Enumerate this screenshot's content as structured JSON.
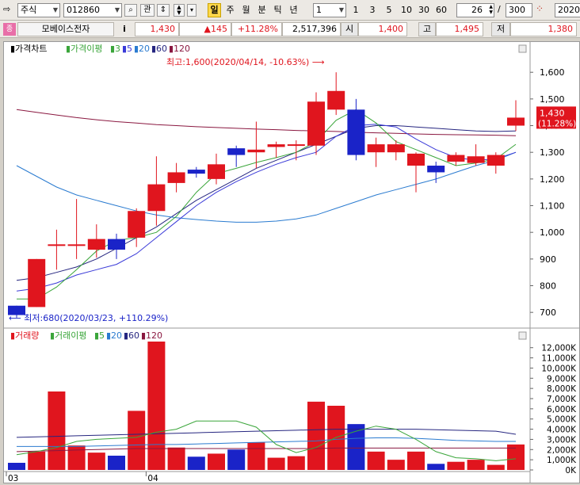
{
  "toolbar": {
    "market": "주식",
    "code": "012860",
    "search_icon": "search-icon",
    "watch_label": "관",
    "period_buttons": [
      "일",
      "주",
      "월",
      "분",
      "틱",
      "년"
    ],
    "active_period": "일",
    "interval_value": "1",
    "interval_buttons": [
      "1",
      "3",
      "5",
      "10",
      "30",
      "60"
    ],
    "count_value": "26",
    "count_sep": "/",
    "count_total": "300",
    "date_value": "2020/"
  },
  "quote": {
    "name": "모베이스전자",
    "info_label": "i",
    "price": "1,430",
    "change": "▲145",
    "change_pct": "+11.28%",
    "volume": "2,517,396",
    "open_label": "시",
    "open": "1,400",
    "high_label": "고",
    "high": "1,495",
    "low_label": "저",
    "low": "1,380"
  },
  "chart_data": [
    {
      "type": "candlestick",
      "title": "가격차트",
      "legend": [
        "가격이평",
        "3",
        "5",
        "20",
        "60",
        "120"
      ],
      "y_ticks": [
        700,
        800,
        900,
        1000,
        1100,
        1200,
        1300,
        1400,
        1500,
        1600
      ],
      "y_tick_labels": [
        "700",
        "800",
        "900",
        "1,000",
        "1,100",
        "1,200",
        "1,300",
        "1,400",
        "1,500",
        "1,600"
      ],
      "ylim": [
        650,
        1660
      ],
      "max_annotation": "최고:1,600(2020/04/14, -10.63%)",
      "min_annotation": "최저:680(2020/03/23, +110.29%)",
      "last_price_label": "1,430",
      "last_pct_label": "(11.28%)",
      "candles": [
        {
          "o": 725,
          "h": 725,
          "l": 680,
          "c": 690
        },
        {
          "o": 720,
          "h": 900,
          "l": 720,
          "c": 900
        },
        {
          "o": 955,
          "h": 1010,
          "l": 860,
          "c": 955
        },
        {
          "o": 950,
          "h": 1125,
          "l": 900,
          "c": 955
        },
        {
          "o": 935,
          "h": 1030,
          "l": 905,
          "c": 975
        },
        {
          "o": 975,
          "h": 995,
          "l": 900,
          "c": 935
        },
        {
          "o": 980,
          "h": 1090,
          "l": 945,
          "c": 1080
        },
        {
          "o": 1080,
          "h": 1285,
          "l": 1025,
          "c": 1180
        },
        {
          "o": 1185,
          "h": 1260,
          "l": 1150,
          "c": 1225
        },
        {
          "o": 1235,
          "h": 1245,
          "l": 1205,
          "c": 1220
        },
        {
          "o": 1200,
          "h": 1295,
          "l": 1180,
          "c": 1255
        },
        {
          "o": 1315,
          "h": 1325,
          "l": 1245,
          "c": 1290
        },
        {
          "o": 1300,
          "h": 1415,
          "l": 1240,
          "c": 1310
        },
        {
          "o": 1320,
          "h": 1340,
          "l": 1280,
          "c": 1330
        },
        {
          "o": 1330,
          "h": 1345,
          "l": 1270,
          "c": 1330
        },
        {
          "o": 1325,
          "h": 1525,
          "l": 1290,
          "c": 1490
        },
        {
          "o": 1460,
          "h": 1600,
          "l": 1440,
          "c": 1530
        },
        {
          "o": 1460,
          "h": 1500,
          "l": 1270,
          "c": 1290
        },
        {
          "o": 1300,
          "h": 1355,
          "l": 1245,
          "c": 1330
        },
        {
          "o": 1300,
          "h": 1345,
          "l": 1270,
          "c": 1330
        },
        {
          "o": 1250,
          "h": 1300,
          "l": 1150,
          "c": 1295
        },
        {
          "o": 1250,
          "h": 1265,
          "l": 1185,
          "c": 1225
        },
        {
          "o": 1265,
          "h": 1300,
          "l": 1250,
          "c": 1290
        },
        {
          "o": 1260,
          "h": 1330,
          "l": 1250,
          "c": 1285
        },
        {
          "o": 1250,
          "h": 1300,
          "l": 1220,
          "c": 1290
        },
        {
          "o": 1400,
          "h": 1495,
          "l": 1380,
          "c": 1430
        }
      ],
      "ma3": [
        750,
        750,
        795,
        860,
        930,
        970,
        980,
        1000,
        1060,
        1150,
        1220,
        1240,
        1262,
        1280,
        1300,
        1340,
        1420,
        1460,
        1410,
        1340,
        1310,
        1280,
        1250,
        1260,
        1275,
        1330
      ],
      "ma5": [
        780,
        790,
        810,
        840,
        860,
        880,
        920,
        980,
        1040,
        1100,
        1150,
        1190,
        1225,
        1255,
        1280,
        1300,
        1360,
        1400,
        1405,
        1395,
        1350,
        1310,
        1280,
        1270,
        1275,
        1300
      ],
      "ma20": [
        1250,
        1210,
        1170,
        1140,
        1120,
        1100,
        1080,
        1065,
        1055,
        1048,
        1042,
        1038,
        1038,
        1042,
        1050,
        1065,
        1090,
        1115,
        1140,
        1160,
        1180,
        1200,
        1225,
        1250,
        1270,
        1300
      ],
      "ma60": [
        820,
        830,
        850,
        870,
        900,
        940,
        980,
        1020,
        1070,
        1120,
        1160,
        1200,
        1240,
        1270,
        1300,
        1330,
        1360,
        1390,
        1400,
        1400,
        1395,
        1390,
        1385,
        1380,
        1378,
        1380
      ],
      "ma120": [
        1460,
        1450,
        1440,
        1430,
        1422,
        1415,
        1410,
        1404,
        1400,
        1396,
        1393,
        1390,
        1387,
        1385,
        1382,
        1380,
        1378,
        1375,
        1373,
        1371,
        1369,
        1367,
        1366,
        1365,
        1364,
        1362
      ]
    },
    {
      "type": "bar",
      "title": "거래량",
      "legend": [
        "거래이평",
        "5",
        "20",
        "60",
        "120"
      ],
      "y_ticks": [
        0,
        1000,
        2000,
        3000,
        4000,
        5000,
        6000,
        7000,
        8000,
        9000,
        10000,
        11000,
        12000
      ],
      "y_tick_labels": [
        "0K",
        "1,000K",
        "2,000K",
        "3,000K",
        "4,000K",
        "5,000K",
        "6,000K",
        "7,000K",
        "8,000K",
        "9,000K",
        "10,000K",
        "11,000K",
        "12,000K"
      ],
      "ylim": [
        0,
        12600
      ],
      "x_labels": [
        {
          "index": 0,
          "text": "03"
        },
        {
          "index": 7,
          "text": "04"
        }
      ],
      "volume_k": [
        700,
        1800,
        7700,
        2400,
        1700,
        1400,
        5800,
        12600,
        2200,
        1300,
        1600,
        2000,
        2700,
        1200,
        1350,
        6700,
        6300,
        4500,
        1800,
        1000,
        1800,
        600,
        800,
        1000,
        500,
        2500
      ],
      "ma5": [
        1500,
        1800,
        2200,
        2800,
        3000,
        3100,
        3200,
        3700,
        4000,
        4800,
        4800,
        4800,
        4200,
        2500,
        1700,
        2200,
        3200,
        3800,
        4300,
        4000,
        3000,
        1800,
        1200,
        1100,
        900,
        1100
      ],
      "ma20": [
        2300,
        2300,
        2300,
        2300,
        2350,
        2400,
        2450,
        2500,
        2500,
        2550,
        2600,
        2650,
        2700,
        2750,
        2800,
        2850,
        3000,
        3100,
        3150,
        3150,
        3100,
        3000,
        2900,
        2850,
        2800,
        2800
      ],
      "ma60": [
        3200,
        3250,
        3300,
        3350,
        3400,
        3450,
        3500,
        3550,
        3600,
        3650,
        3700,
        3750,
        3800,
        3850,
        3900,
        3950,
        4000,
        4000,
        4000,
        4000,
        4000,
        3950,
        3900,
        3850,
        3800,
        3500
      ],
      "ma120": [
        1800,
        1850,
        1900,
        1950,
        2000,
        2050,
        2100,
        2100,
        2100,
        2100,
        2100,
        2100,
        2100,
        2100,
        2100,
        2100,
        2150,
        2150,
        2150,
        2150,
        2150,
        2150,
        2150,
        2150,
        2150,
        2150
      ]
    }
  ],
  "colors": {
    "up": "#e0151e",
    "down": "#1a23c8",
    "ma3": "#3aa53a",
    "ma5": "#3a3ad8",
    "ma20": "#2a7bd0",
    "ma60": "#262680",
    "ma120": "#8a1840"
  }
}
